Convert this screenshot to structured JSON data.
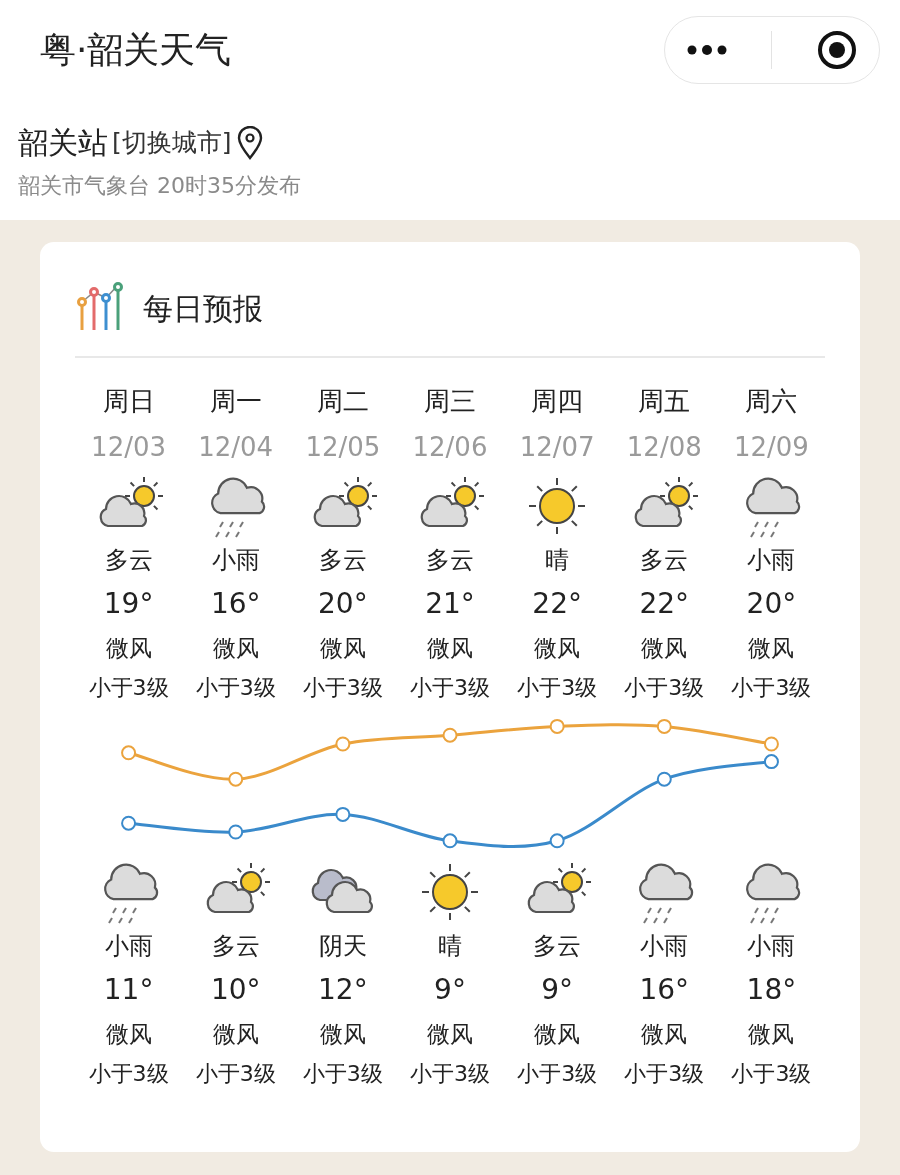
{
  "app_bar": {
    "title": "粤·韶关天气"
  },
  "station": {
    "name": "韶关站",
    "switch_link": "[切换城市]",
    "publisher": "韶关市气象台 20时35分发布"
  },
  "forecast": {
    "title": "每日预报",
    "days": [
      {
        "weekday": "周日",
        "date": "12/03",
        "day": {
          "kind": "partly",
          "condition": "多云",
          "temp": "19°",
          "wind": "微风",
          "wind_level": "小于3级"
        },
        "night": {
          "kind": "rain",
          "condition": "小雨",
          "temp": "11°",
          "wind": "微风",
          "wind_level": "小于3级"
        }
      },
      {
        "weekday": "周一",
        "date": "12/04",
        "day": {
          "kind": "rain",
          "condition": "小雨",
          "temp": "16°",
          "wind": "微风",
          "wind_level": "小于3级"
        },
        "night": {
          "kind": "partly",
          "condition": "多云",
          "temp": "10°",
          "wind": "微风",
          "wind_level": "小于3级"
        }
      },
      {
        "weekday": "周二",
        "date": "12/05",
        "day": {
          "kind": "partly",
          "condition": "多云",
          "temp": "20°",
          "wind": "微风",
          "wind_level": "小于3级"
        },
        "night": {
          "kind": "overcast",
          "condition": "阴天",
          "temp": "12°",
          "wind": "微风",
          "wind_level": "小于3级"
        }
      },
      {
        "weekday": "周三",
        "date": "12/06",
        "day": {
          "kind": "partly",
          "condition": "多云",
          "temp": "21°",
          "wind": "微风",
          "wind_level": "小于3级"
        },
        "night": {
          "kind": "sunny",
          "condition": "晴",
          "temp": "9°",
          "wind": "微风",
          "wind_level": "小于3级"
        }
      },
      {
        "weekday": "周四",
        "date": "12/07",
        "day": {
          "kind": "sunny",
          "condition": "晴",
          "temp": "22°",
          "wind": "微风",
          "wind_level": "小于3级"
        },
        "night": {
          "kind": "partly",
          "condition": "多云",
          "temp": "9°",
          "wind": "微风",
          "wind_level": "小于3级"
        }
      },
      {
        "weekday": "周五",
        "date": "12/08",
        "day": {
          "kind": "partly",
          "condition": "多云",
          "temp": "22°",
          "wind": "微风",
          "wind_level": "小于3级"
        },
        "night": {
          "kind": "rain",
          "condition": "小雨",
          "temp": "16°",
          "wind": "微风",
          "wind_level": "小于3级"
        }
      },
      {
        "weekday": "周六",
        "date": "12/09",
        "day": {
          "kind": "rain",
          "condition": "小雨",
          "temp": "20°",
          "wind": "微风",
          "wind_level": "小于3级"
        },
        "night": {
          "kind": "rain",
          "condition": "小雨",
          "temp": "18°",
          "wind": "微风",
          "wind_level": "小于3级"
        }
      }
    ]
  }
}
